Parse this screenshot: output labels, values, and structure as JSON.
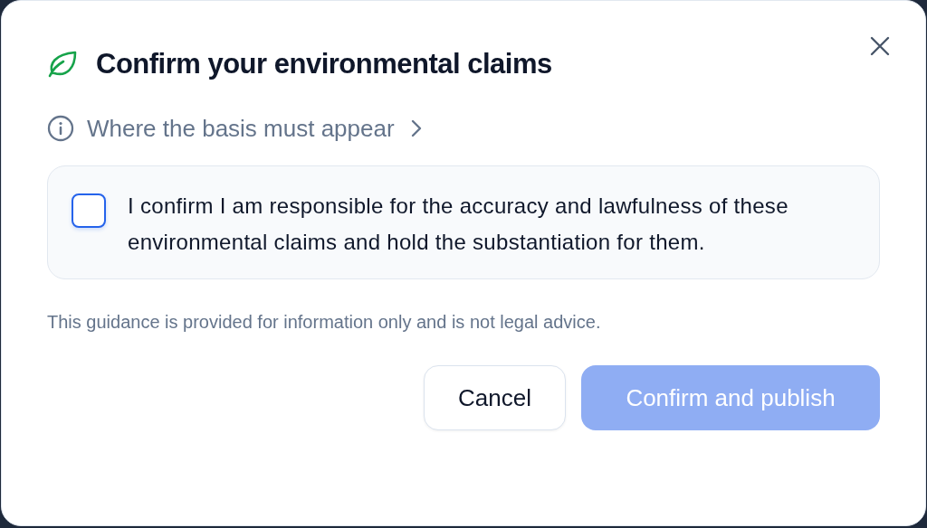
{
  "dialog": {
    "title": "Confirm your environmental claims",
    "info_link": "Where the basis must appear",
    "confirmation": {
      "label": "I confirm I am responsible for the accuracy and lawfulness of these environmental claims and hold the substantiation for them.",
      "checked": false
    },
    "disclaimer": "This guidance is provided for information only and is not legal advice.",
    "buttons": [
      {
        "label": "Cancel",
        "kind": "secondary",
        "disabled": false
      },
      {
        "label": "Confirm and publish",
        "kind": "primary",
        "disabled": true
      }
    ]
  }
}
